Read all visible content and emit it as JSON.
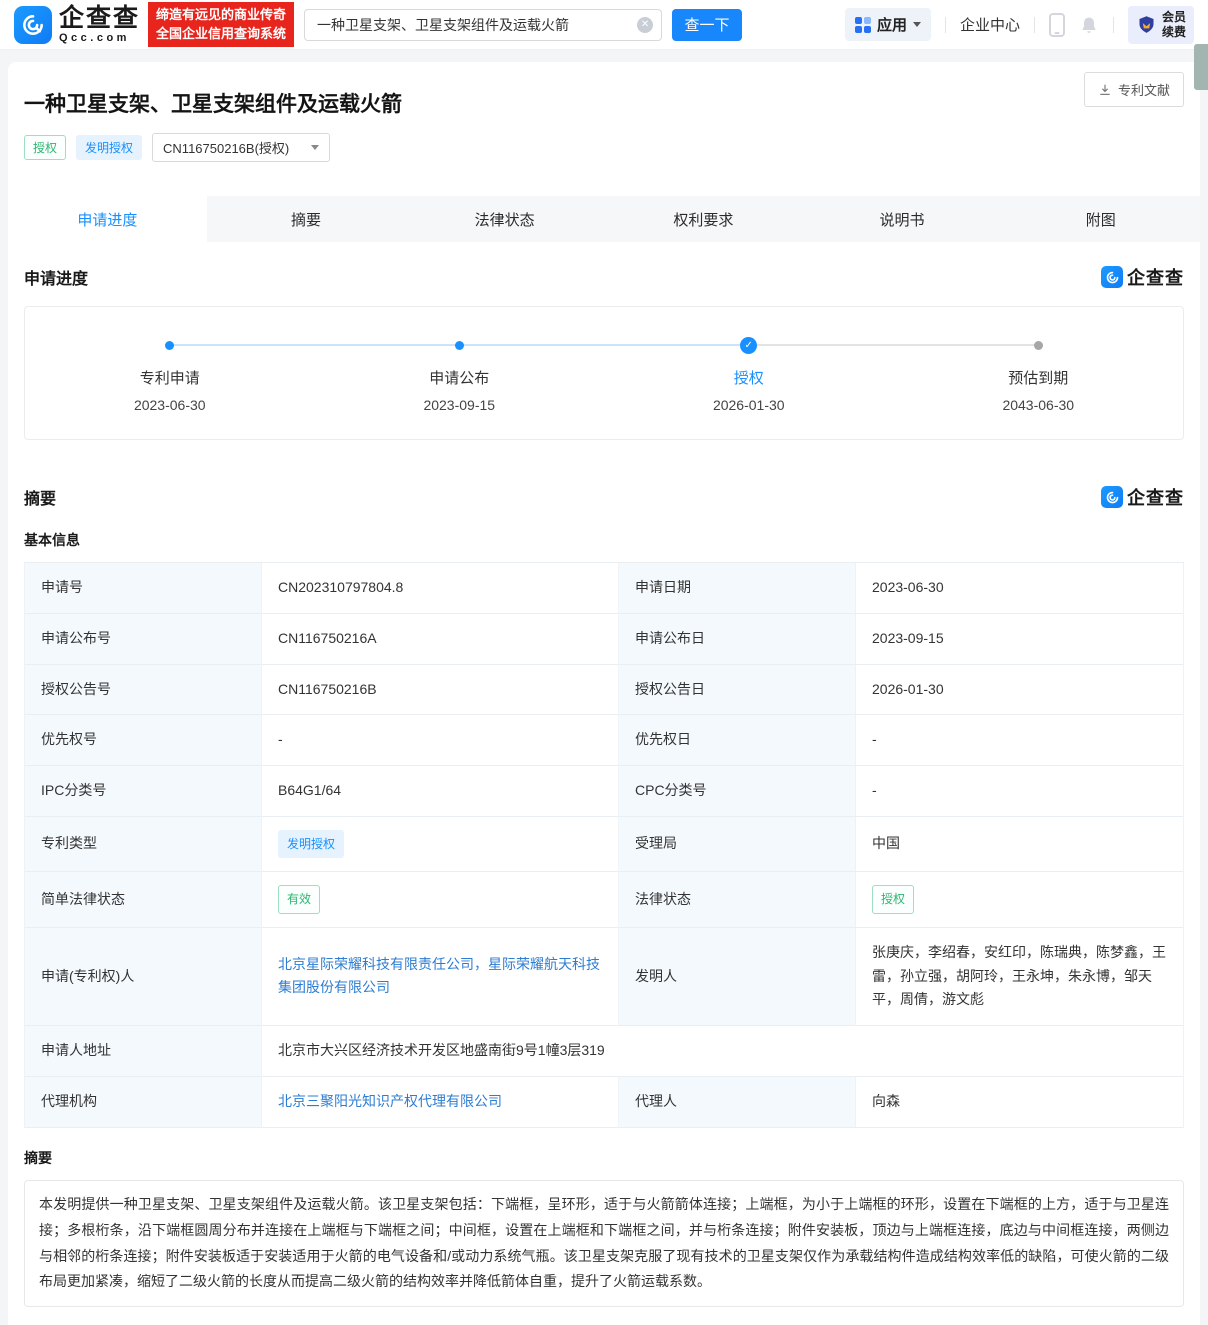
{
  "header": {
    "brand": {
      "name": "企查查",
      "domain": "Qcc.com",
      "slogan1": "缔造有远见的商业传奇",
      "slogan2": "全国企业信用查询系统"
    },
    "search": {
      "value": "一种卫星支架、卫星支架组件及运载火箭",
      "button_label": "查一下"
    },
    "nav": {
      "apps_label": "应用",
      "enterprise_center_label": "企业中心",
      "member_line1": "会员",
      "member_line2": "续费"
    }
  },
  "icons": {
    "clear_icon": "✕",
    "check_icon": "✓"
  },
  "watermark_brand": "企查查",
  "patent": {
    "title": "一种卫星支架、卫星支架组件及运载火箭",
    "status_badge": "授权",
    "type_badge": "发明授权",
    "publication_select": "CN116750216B(授权)",
    "doc_button_label": "专利文献"
  },
  "tabs": [
    {
      "label": "申请进度",
      "active": true
    },
    {
      "label": "摘要",
      "active": false
    },
    {
      "label": "法律状态",
      "active": false
    },
    {
      "label": "权利要求",
      "active": false
    },
    {
      "label": "说明书",
      "active": false
    },
    {
      "label": "附图",
      "active": false
    }
  ],
  "progress": {
    "section_title": "申请进度",
    "steps": [
      {
        "label": "专利申请",
        "date": "2023-06-30",
        "state": "done"
      },
      {
        "label": "申请公布",
        "date": "2023-09-15",
        "state": "done"
      },
      {
        "label": "授权",
        "date": "2026-01-30",
        "state": "current"
      },
      {
        "label": "预估到期",
        "date": "2043-06-30",
        "state": "future"
      }
    ]
  },
  "summary": {
    "section_title": "摘要",
    "basic_info_title": "基本信息",
    "rows": [
      {
        "l1": "申请号",
        "v1": "CN202310797804.8",
        "l2": "申请日期",
        "v2": "2023-06-30"
      },
      {
        "l1": "申请公布号",
        "v1": "CN116750216A",
        "l2": "申请公布日",
        "v2": "2023-09-15"
      },
      {
        "l1": "授权公告号",
        "v1": "CN116750216B",
        "l2": "授权公告日",
        "v2": "2026-01-30"
      },
      {
        "l1": "优先权号",
        "v1": "-",
        "l2": "优先权日",
        "v2": "-"
      },
      {
        "l1": "IPC分类号",
        "v1": "B64G1/64",
        "l2": "CPC分类号",
        "v2": "-"
      },
      {
        "l1": "专利类型",
        "v1": "发明授权",
        "l2": "受理局",
        "v2": "中国"
      },
      {
        "l1": "简单法律状态",
        "v1": "有效",
        "l2": "法律状态",
        "v2": "授权"
      },
      {
        "l1": "申请(专利权)人",
        "v1": "北京星际荣耀科技有限责任公司，星际荣耀航天科技集团股份有限公司",
        "l2": "发明人",
        "v2": "张庚庆，李绍春，安红印，陈瑞典，陈梦鑫，王雷，孙立强，胡阿玲，王永坤，朱永博，邹天平，周倩，游文彪"
      },
      {
        "l1": "申请人地址",
        "v1": "北京市大兴区经济技术开发区地盛南街9号1幢3层319"
      },
      {
        "l1": "代理机构",
        "v1": "北京三聚阳光知识产权代理有限公司",
        "l2": "代理人",
        "v2": "向森"
      }
    ],
    "abstract_title": "摘要",
    "abstract_text": "本发明提供一种卫星支架、卫星支架组件及运载火箭。该卫星支架包括：下端框，呈环形，适于与火箭箭体连接；上端框，为小于上端框的环形，设置在下端框的上方，适于与卫星连接；多根桁条，沿下端框圆周分布并连接在上端框与下端框之间；中间框，设置在上端框和下端框之间，并与桁条连接；附件安装板，顶边与上端框连接，底边与中间框连接，两侧边与相邻的桁条连接；附件安装板适于安装适用于火箭的电气设备和/或动力系统气瓶。该卫星支架克服了现有技术的卫星支架仅作为承载结构件造成结构效率低的缺陷，可使火箭的二级布局更加紧凑，缩短了二级火箭的长度从而提高二级火箭的结构效率并降低箭体自重，提升了火箭运载系数。"
  },
  "colors": {
    "accent": "#1787fb",
    "brand_red": "#e7251d",
    "green": "#2db56f",
    "link": "#2d7dd2"
  }
}
